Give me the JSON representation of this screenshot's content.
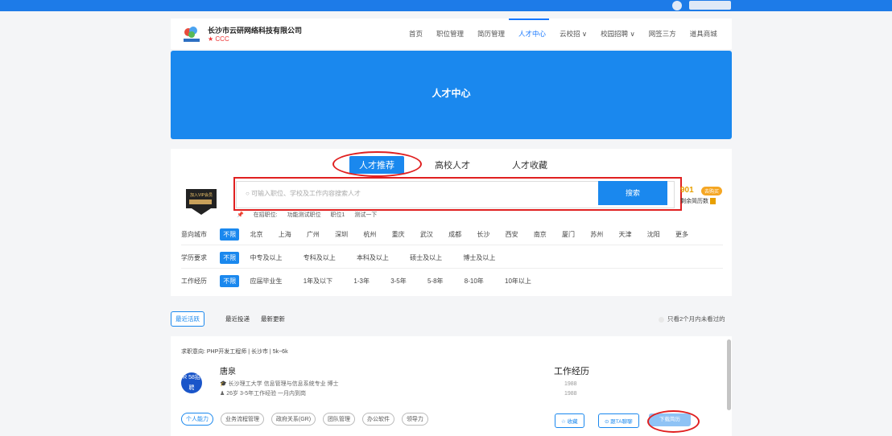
{
  "topbar": {
    "left_text": "",
    "right_text": ""
  },
  "header": {
    "company_name": "长沙市云研网络科技有限公司",
    "company_tag": "★ CCC",
    "nav": [
      "首页",
      "职位管理",
      "简历管理",
      "人才中心",
      "云校招 ∨",
      "校园招聘 ∨",
      "网签三方",
      "道具商城"
    ],
    "nav_active_index": 3
  },
  "banner": {
    "title": "人才中心"
  },
  "tabs": [
    "人才推荐",
    "高校人才",
    "人才收藏"
  ],
  "search": {
    "placeholder": "可输入职位、学校及工作内容搜索人才",
    "button": "搜索",
    "count": "901",
    "count_badge": "去购买",
    "count_label": "剩余简历数",
    "history_label": "在招职位:",
    "history_items": [
      "功能测试职位",
      "职位1",
      "测试一下"
    ]
  },
  "filters": {
    "city": {
      "label": "意向城市",
      "selected": "不限",
      "options": [
        "北京",
        "上海",
        "广州",
        "深圳",
        "杭州",
        "重庆",
        "武汉",
        "成都",
        "长沙",
        "西安",
        "南京",
        "厦门",
        "苏州",
        "天津",
        "沈阳",
        "更多"
      ]
    },
    "education": {
      "label": "学历要求",
      "selected": "不限",
      "options": [
        "中专及以上",
        "专科及以上",
        "本科及以上",
        "硕士及以上",
        "博士及以上"
      ]
    },
    "experience": {
      "label": "工作经历",
      "selected": "不限",
      "options": [
        "应届毕业生",
        "1年及以下",
        "1-3年",
        "3-5年",
        "5-8年",
        "8-10年",
        "10年以上"
      ]
    }
  },
  "sort": {
    "active": "最近活跃",
    "options": [
      "最近投递",
      "最新更新"
    ],
    "right_label": "只看2个月内未看过的"
  },
  "card": {
    "intent": "求职意向: PHP开发工程师 | 长沙市 | 5k~6k",
    "avatar_text": "R 58招聘",
    "name": "唐泉",
    "edu": "长沙理工大学  信息管理与信息系统专业  博士",
    "exp": "26岁  3-5年工作经验  一月内到岗",
    "work_title": "工作经历",
    "work_years": [
      "1988",
      "1988"
    ],
    "skills": [
      "个人能力",
      "业务流程管理",
      "政府关系(GR)",
      "团队管理",
      "办公软件",
      "领导力"
    ],
    "btn_collect": "☆ 收藏",
    "btn_chat": "⊙ 跟TA聊聊",
    "btn_download": "下载简历"
  },
  "colors": {
    "primary": "#1a88ee",
    "highlight": "#e02020",
    "accent": "#f5a623"
  }
}
